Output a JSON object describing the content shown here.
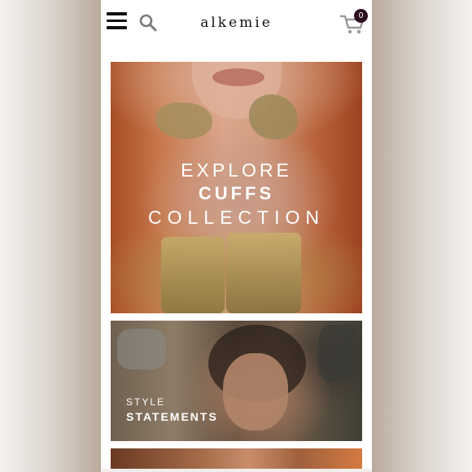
{
  "header": {
    "brand": "alkemie",
    "cart_count": "0",
    "icons": [
      "menu-icon",
      "search-icon",
      "cart-icon"
    ]
  },
  "banners": [
    {
      "line1": "EXPLORE",
      "line2": "CUFFS",
      "line3": "COLLECTION"
    },
    {
      "line1": "STYLE",
      "line2": "STATEMENTS"
    }
  ],
  "colors": {
    "badge": "#2c1020",
    "icon_dark": "#111111",
    "icon_gray": "#7a7a7a",
    "cart_gray": "#9a9a9a"
  }
}
